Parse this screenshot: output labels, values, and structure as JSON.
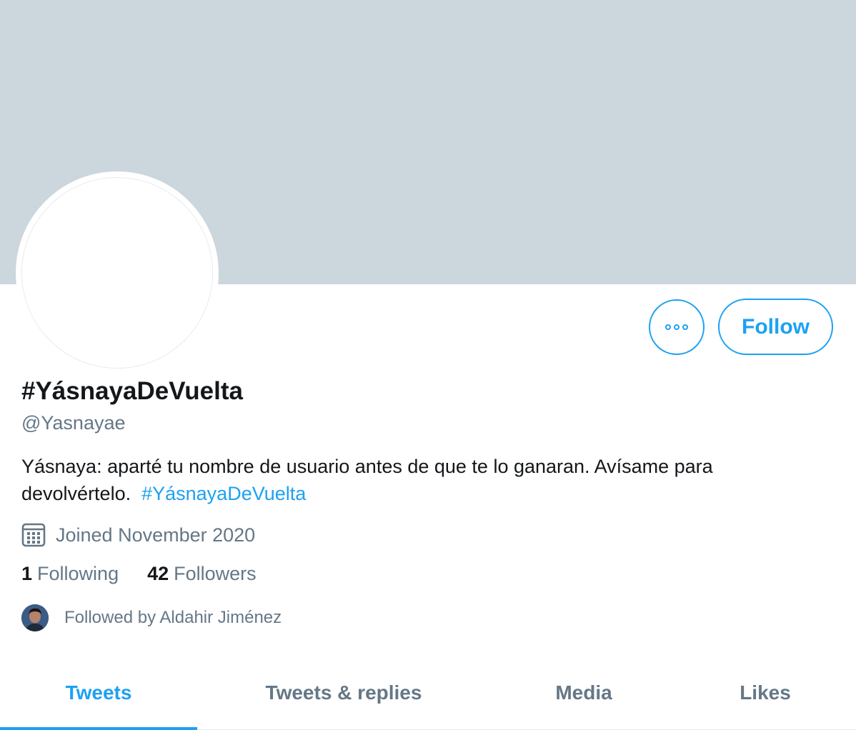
{
  "profile": {
    "display_name": "#YásnayaDeVuelta",
    "handle": "@Yasnayae",
    "bio_text": "Yásnaya: aparté tu nombre de usuario antes de que te lo ganaran. Avísame para devolvértelo.",
    "bio_hashtag": "#YásnayaDeVuelta",
    "joined": "Joined November 2020"
  },
  "actions": {
    "more_icon": "more-horizontal-icon",
    "follow_label": "Follow"
  },
  "stats": {
    "following_count": "1",
    "following_label": "Following",
    "followers_count": "42",
    "followers_label": "Followers"
  },
  "followed_by": {
    "text": "Followed by Aldahir Jiménez"
  },
  "tabs": [
    {
      "label": "Tweets",
      "active": true
    },
    {
      "label": "Tweets & replies",
      "active": false
    },
    {
      "label": "Media",
      "active": false
    },
    {
      "label": "Likes",
      "active": false
    }
  ],
  "colors": {
    "accent": "#1da1f2",
    "banner": "#ccd6dd",
    "secondary_text": "#657786",
    "primary_text": "#14171a"
  }
}
